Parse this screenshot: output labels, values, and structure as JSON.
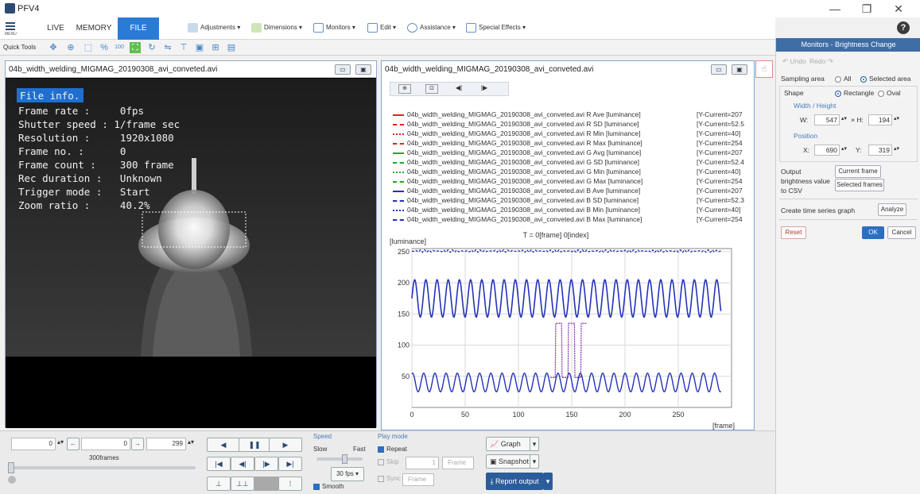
{
  "app": {
    "title": "PFV4"
  },
  "window_controls": {
    "minimize": "—",
    "maximize": "❐",
    "close": "✕"
  },
  "menubar": {
    "menu_label": "MENU",
    "tabs": [
      "LIVE",
      "MEMORY",
      "FILE"
    ],
    "items": [
      "Adjustments",
      "Dimensions",
      "Monitors",
      "Edit",
      "Assistance",
      "Special Effects"
    ]
  },
  "quick_tools": {
    "label": "Quick Tools",
    "zoom_100": "100"
  },
  "video_window": {
    "title": "04b_width_welding_MIGMAG_20190308_avi_conveted.avi",
    "file_info_title": "File info.",
    "file_info": [
      "Frame rate :     0fps",
      "Shutter speed : 1/frame sec",
      "Resolution :     1920x1080",
      "Frame no. :      0",
      "Frame count :    300 frame",
      "Rec duration :   Unknown",
      "Trigger mode :   Start",
      "Zoom ratio :     40.2%"
    ]
  },
  "graph_window": {
    "title": "04b_width_welding_MIGMAG_20190308_avi_conveted.avi",
    "legend": [
      {
        "label": "04b_width_welding_MIGMAG_20190308_avi_conveted.avi R Ave  [luminance]",
        "current": "[Y-Current=207",
        "color": "#e0241c",
        "dash": "solid"
      },
      {
        "label": "04b_width_welding_MIGMAG_20190308_avi_conveted.avi R SD  [luminance]",
        "current": "[Y-Current=52.5",
        "color": "#e0241c",
        "dash": "dashdot"
      },
      {
        "label": "04b_width_welding_MIGMAG_20190308_avi_conveted.avi R Min  [luminance]",
        "current": "[Y-Current=40]",
        "color": "#e0241c",
        "dash": "dotted"
      },
      {
        "label": "04b_width_welding_MIGMAG_20190308_avi_conveted.avi R Max  [luminance]",
        "current": "[Y-Current=254",
        "color": "#e0241c",
        "dash": "dashed"
      },
      {
        "label": "04b_width_welding_MIGMAG_20190308_avi_conveted.avi G Avg  [luminance]",
        "current": "[Y-Current=207",
        "color": "#1faa2c",
        "dash": "solid"
      },
      {
        "label": "04b_width_welding_MIGMAG_20190308_avi_conveted.avi G SD  [luminance]",
        "current": "[Y-Current=52.4",
        "color": "#1faa2c",
        "dash": "dashdot"
      },
      {
        "label": "04b_width_welding_MIGMAG_20190308_avi_conveted.avi G Min  [luminance]",
        "current": "[Y-Current=40]",
        "color": "#1faa2c",
        "dash": "dotted"
      },
      {
        "label": "04b_width_welding_MIGMAG_20190308_avi_conveted.avi G Max  [luminance]",
        "current": "[Y-Current=254",
        "color": "#1faa2c",
        "dash": "dashed"
      },
      {
        "label": "04b_width_welding_MIGMAG_20190308_avi_conveted.avi B Ave  [luminance]",
        "current": "[Y-Current=207",
        "color": "#2433b8",
        "dash": "solid"
      },
      {
        "label": "04b_width_welding_MIGMAG_20190308_avi_conveted.avi B SD  [luminance]",
        "current": "[Y-Current=52.3",
        "color": "#2433b8",
        "dash": "dashdot"
      },
      {
        "label": "04b_width_welding_MIGMAG_20190308_avi_conveted.avi B Min  [luminance]",
        "current": "[Y-Current=40]",
        "color": "#2433b8",
        "dash": "dotted"
      },
      {
        "label": "04b_width_welding_MIGMAG_20190308_avi_conveted.avi B Max  [luminance]",
        "current": "[Y-Current=254",
        "color": "#2433b8",
        "dash": "dashed"
      }
    ]
  },
  "chart_data": {
    "type": "line",
    "title": "T = 0[frame] 0[index]",
    "ylabel": "[luminance]",
    "xlabel": "[frame]",
    "xlim": [
      0,
      300
    ],
    "ylim": [
      0,
      255
    ],
    "x_ticks": [
      0,
      50,
      100,
      150,
      200,
      250
    ],
    "y_ticks": [
      50,
      100,
      150,
      200,
      250
    ],
    "grid": true,
    "series": [
      {
        "name": "Max",
        "values_desc": "flat ~254",
        "level": 254
      },
      {
        "name": "Ave",
        "level": 175,
        "amplitude": 30,
        "period": 10.5
      },
      {
        "name": "SD",
        "level": 40,
        "amplitude": 15,
        "period": 10.5
      },
      {
        "name": "Min",
        "level": 40,
        "bump_start": 105,
        "bump_end": 165,
        "bump_level": 135
      }
    ]
  },
  "right_panel": {
    "title": "Monitors - Brightness Change",
    "undo": "Undo",
    "redo": "Redo",
    "sampling_area": "Sampling area",
    "all": "All",
    "selected_area": "Selected area",
    "shape": "Shape",
    "rectangle": "Rectangle",
    "oval": "Oval",
    "width_height": "Width / Height",
    "w_label": "W:",
    "w_value": "547",
    "h_label": "H:",
    "h_value": "194",
    "position": "Position",
    "x_label": "X:",
    "x_value": "690",
    "y_label": "Y:",
    "y_value": "319",
    "output_label_1": "Output",
    "output_label_2": "brightness value",
    "output_label_3": "to CSV",
    "current_frame": "Current frame",
    "selected_frames": "Selected frames",
    "create_ts": "Create time series graph",
    "analyze": "Analyze",
    "reset": "Reset",
    "ok": "OK",
    "cancel": "Cancel"
  },
  "bottom": {
    "start_value": "0",
    "current_value": "0",
    "end_value": "299",
    "frames_label": "300frames",
    "speed_title": "Speed",
    "slow": "Slow",
    "fast": "Fast",
    "fps": "30 fps",
    "smooth": "Smooth",
    "playmode_title": "Play mode",
    "repeat": "Repeat",
    "skip": "Skip",
    "skip_value": "1",
    "frame_unit": "Frame",
    "sync": "Sync",
    "graph": "Graph",
    "snapshot": "Snapshot",
    "report_output": "Report output"
  }
}
